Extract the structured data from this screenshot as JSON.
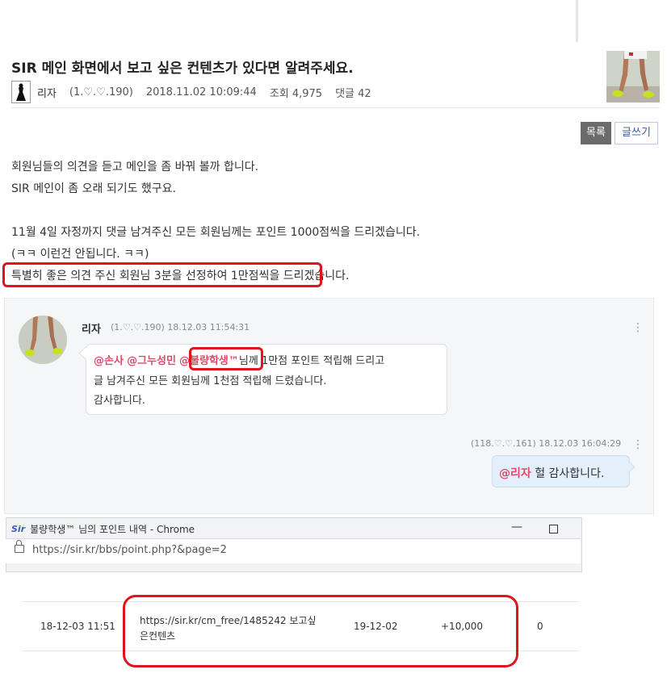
{
  "post": {
    "title": "SIR 메인 화면에서 보고 싶은 컨텐츠가 있다면 알려주세요.",
    "author": "리자",
    "ip": "(1.♡.♡.190)",
    "datetime": "2018.11.02 10:09:44",
    "views": "조회 4,975",
    "comments": "댓글 42",
    "btn_list": "목록",
    "btn_write": "글쓰기",
    "body": [
      "회원님들의 의견을 듣고 메인을 좀 바꿔 볼까 합니다.",
      "SIR 메인이 좀 오래 되기도 했구요.",
      "11월 4일 자정까지 댓글 남겨주신 모든 회원님께는 포인트 1000점씩을 드리겠습니다.",
      "(ㅋㅋ 이런건 안됩니다. ㅋㅋ)",
      "특별히 좋은 의견 주신 회원님 3분을 선정하여 1만점씩을 드리겠습니다."
    ]
  },
  "comment": {
    "author": "리자",
    "meta": "(1.♡.♡.190) 18.12.03 11:54:31",
    "mention1": "@손사",
    "mention2": "@그누성민",
    "mention3": "@불량학생™",
    "line1_rest": "님께 1만점 포인트 적립해 드리고",
    "line2": "글 남겨주신 모든 회원님께 1천점 적립해 드렸습니다.",
    "line3": "감사합니다."
  },
  "reply": {
    "meta": "(118.♡.♡.161) 18.12.03 16:04:29",
    "mention": "@리자",
    "text": " 헐 감사합니다."
  },
  "chrome": {
    "title": "불량학생™ 님의 포인트 내역 - Chrome",
    "url": "https://sir.kr/bbs/point.php?&page=2",
    "logo": "Sir"
  },
  "point_row": {
    "date": "18-12-03 11:51",
    "link_line1": "https://sir.kr/cm_free/1485242 보고싶",
    "link_line2": "은컨텐츠",
    "expire": "19-12-02",
    "amount": "+10,000",
    "used": "0"
  },
  "colors": {
    "mention": "#e04a6a",
    "highlight": "#e0141c"
  }
}
